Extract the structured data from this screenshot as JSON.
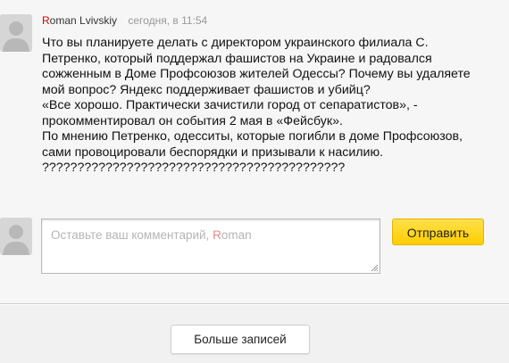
{
  "comment": {
    "author_first_letter": "R",
    "author_rest": "oman Lvivskiy",
    "timestamp": "сегодня, в 11:54",
    "text": "Что вы планируете делать с директором украинского филиала С.\nПетренко, который поддержал фашистов на Украине и радовался\nсожженным в Доме Профсоюзов жителей Одессы? Почему вы удаляете\nмой вопрос? Яндекс поддерживает фашистов и убийц?\n«Все хорошо. Практически зачистили город от сепаратистов», -\nпрокомментировал он события 2 мая в «Фейсбук».\nПо мнению Петренко, одесситы, которые погибли в доме Профсоюзов,\nсами провоцировали беспорядки и призывали к насилию.\n???????????????????????????????????????????"
  },
  "reply": {
    "placeholder_before": "Оставьте ваш комментарий, ",
    "placeholder_name_first": "R",
    "placeholder_name_rest": "oman",
    "send_label": "Отправить"
  },
  "more_label": "Больше записей",
  "icons": [
    "avatar-placeholder-icon",
    "resize-grip-icon"
  ],
  "colors": {
    "author_accent": "#d40000",
    "send_button": "#ffd21f"
  }
}
